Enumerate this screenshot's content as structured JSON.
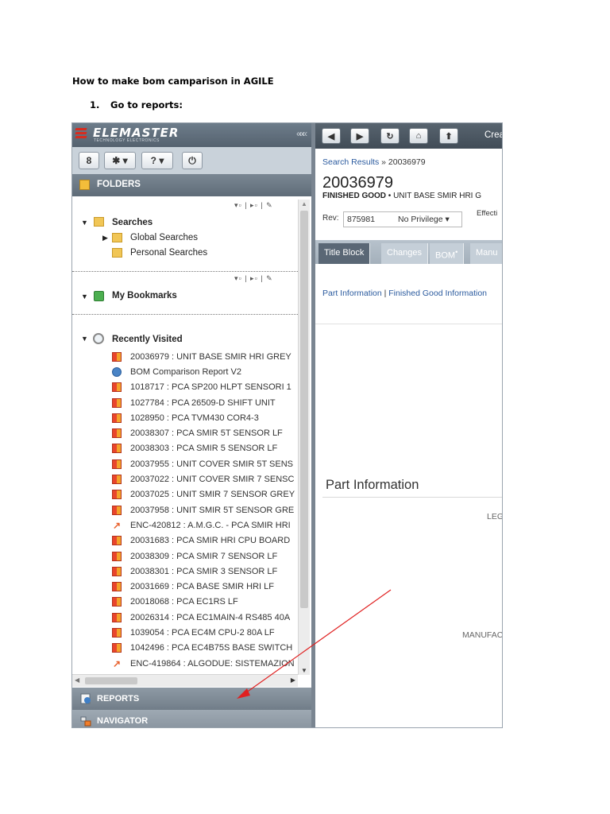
{
  "document": {
    "title": "How to make bom camparison in AGILE",
    "step_number": "1.",
    "step_text": "Go to reports:"
  },
  "app": {
    "logo_text": "ELEMASTER",
    "logo_sub": "TECHNOLOGY ELECTRONICS",
    "collapse_glyph": "«««",
    "toolbar": {
      "user_icon": "8",
      "settings": "✱ ▾",
      "help": "? ▾",
      "power": "⏻"
    },
    "folders_label": "FOLDERS",
    "searches": {
      "label": "Searches",
      "children": [
        "Global Searches",
        "Personal Searches"
      ]
    },
    "bookmarks_label": "My Bookmarks",
    "recent": {
      "label": "Recently Visited",
      "items": [
        {
          "type": "part",
          "text": "20036979 : UNIT BASE SMIR HRI GREY"
        },
        {
          "type": "report",
          "text": "BOM Comparison Report V2"
        },
        {
          "type": "part",
          "text": "1018717 : PCA SP200 HLPT SENSORI 1"
        },
        {
          "type": "part",
          "text": "1027784 : PCA 26509-D SHIFT UNIT"
        },
        {
          "type": "part",
          "text": "1028950 : PCA TVM430 COR4-3"
        },
        {
          "type": "part",
          "text": "20038307 : PCA SMIR 5T SENSOR LF"
        },
        {
          "type": "part",
          "text": "20038303 : PCA SMIR 5 SENSOR LF"
        },
        {
          "type": "part",
          "text": "20037955 : UNIT COVER SMIR 5T SENS"
        },
        {
          "type": "part",
          "text": "20037022 : UNIT COVER SMIR 7 SENSC"
        },
        {
          "type": "part",
          "text": "20037025 : UNIT SMIR 7 SENSOR GREY"
        },
        {
          "type": "part",
          "text": "20037958 : UNIT SMIR 5T SENSOR GRE"
        },
        {
          "type": "change",
          "text": "ENC-420812 : A.M.G.C. - PCA SMIR HRI"
        },
        {
          "type": "part",
          "text": "20031683 : PCA SMIR HRI CPU BOARD"
        },
        {
          "type": "part",
          "text": "20038309 : PCA SMIR 7 SENSOR LF"
        },
        {
          "type": "part",
          "text": "20038301 : PCA SMIR 3 SENSOR LF"
        },
        {
          "type": "part",
          "text": "20031669 : PCA BASE SMIR HRI LF"
        },
        {
          "type": "part",
          "text": "20018068 : PCA EC1RS LF"
        },
        {
          "type": "part",
          "text": "20026314 : PCA EC1MAIN-4 RS485 40A"
        },
        {
          "type": "part",
          "text": "1039054 : PCA EC4M CPU-2 80A LF"
        },
        {
          "type": "part",
          "text": "1042496 : PCA EC4B75S BASE SWITCH"
        },
        {
          "type": "change",
          "text": "ENC-419864 : ALGODUE: SISTEMAZION"
        }
      ]
    },
    "reports_label": "REPORTS",
    "navigator_label": "NAVIGATOR",
    "nav": {
      "back": "◀",
      "forward": "▶",
      "refresh": "↻",
      "home": "⌂",
      "up": "⬆",
      "create_text": "Crea"
    },
    "breadcrumb": {
      "link": "Search Results",
      "sep": " » ",
      "current": "20036979"
    },
    "part_number": "20036979",
    "part_class": "FINISHED GOOD",
    "part_desc": " • UNIT BASE SMIR HRI G",
    "rev_label": "Rev:",
    "rev_value": "875981",
    "privilege": "No Privilege ▾",
    "effective_label": "Effecti",
    "tabs": [
      "Title Block",
      "Changes",
      "BOM",
      "Manu"
    ],
    "sublinks": {
      "a": "Part Information",
      "sep": " | ",
      "b": "Finished Good Information"
    },
    "section_title": "Part Information",
    "field_labels": {
      "leg": "LEG",
      "manufac": "MANUFAC"
    },
    "colors": {
      "accent_link": "#2a5a9e",
      "annotation_arrow": "#e02020",
      "logo_red": "#d62c1f"
    }
  }
}
